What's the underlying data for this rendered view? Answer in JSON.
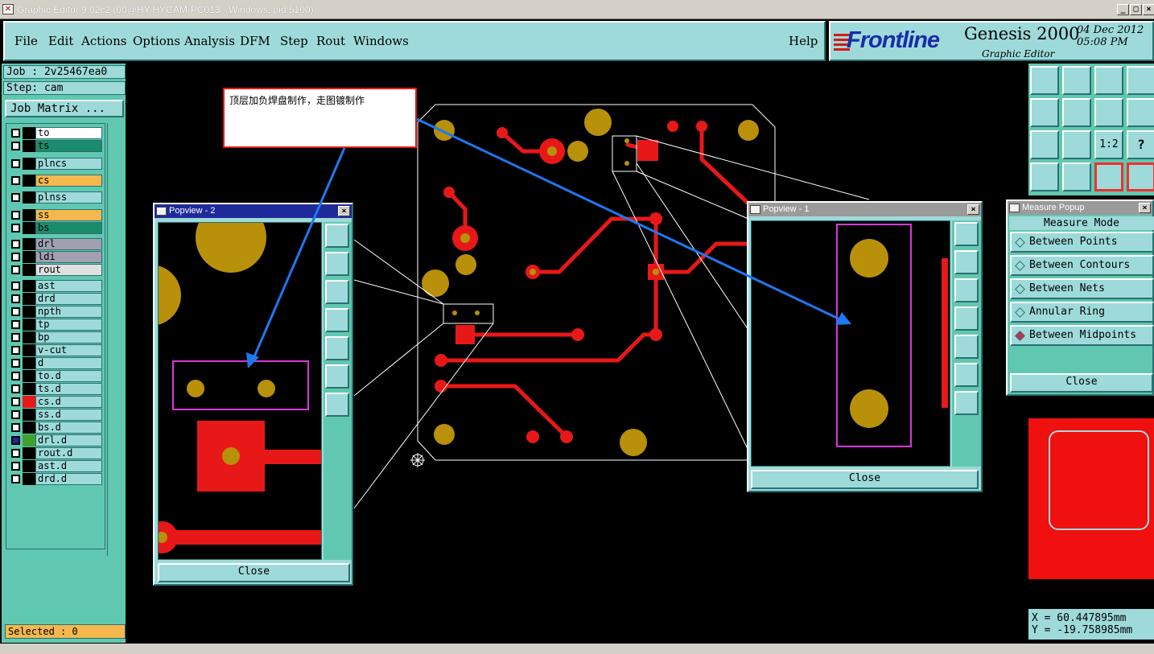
{
  "window": {
    "title": "Graphic Editor 9.02c2 (00@HY-HYCAM-PC013 - Windows, pid:5100)"
  },
  "menu": {
    "items": [
      "File",
      "Edit",
      "Actions",
      "Options",
      "Analysis",
      "DFM",
      "Step",
      "Rout",
      "Windows"
    ],
    "help": "Help"
  },
  "brand": {
    "logo": "Frontline",
    "product": "Genesis 2000",
    "subtitle": "Graphic Editor",
    "date": "04 Dec 2012",
    "time": "05:08 PM"
  },
  "job": {
    "job_label": "Job : 2v25467ea0",
    "step_label": "Step: cam",
    "matrix_button": "Job Matrix ..."
  },
  "layers": [
    {
      "name": "to",
      "color": "#ffffff",
      "swatch": "#000000"
    },
    {
      "name": "ts",
      "color": "#1a8c6c",
      "swatch": "#000000"
    },
    {
      "name": "plncs",
      "color": "#9edada",
      "swatch": "#000000"
    },
    {
      "name": "cs",
      "color": "#f4b84e",
      "swatch": "#000000"
    },
    {
      "name": "plnss",
      "color": "#9edada",
      "swatch": "#000000"
    },
    {
      "name": "ss",
      "color": "#f4b84e",
      "swatch": "#000000"
    },
    {
      "name": "bs",
      "color": "#1a8c6c",
      "swatch": "#000000"
    },
    {
      "name": "drl",
      "color": "#a0a0b0",
      "swatch": "#000000"
    },
    {
      "name": "ldi",
      "color": "#a0a0b0",
      "swatch": "#000000"
    },
    {
      "name": "rout",
      "color": "#e0e0e0",
      "swatch": "#000000"
    },
    {
      "name": "ast",
      "color": "#9edada",
      "swatch": "#000000"
    },
    {
      "name": "drd",
      "color": "#9edada",
      "swatch": "#000000"
    },
    {
      "name": "npth",
      "color": "#9edada",
      "swatch": "#000000"
    },
    {
      "name": "tp",
      "color": "#9edada",
      "swatch": "#000000"
    },
    {
      "name": "bp",
      "color": "#9edada",
      "swatch": "#000000"
    },
    {
      "name": "v-cut",
      "color": "#9edada",
      "swatch": "#000000"
    },
    {
      "name": "d",
      "color": "#9edada",
      "swatch": "#000000"
    },
    {
      "name": "to.d",
      "color": "#9edada",
      "swatch": "#000000"
    },
    {
      "name": "ts.d",
      "color": "#9edada",
      "swatch": "#000000"
    },
    {
      "name": "cs.d",
      "color": "#9edada",
      "swatch": "#e81818"
    },
    {
      "name": "ss.d",
      "color": "#9edada",
      "swatch": "#000000"
    },
    {
      "name": "bs.d",
      "color": "#9edada",
      "swatch": "#000000"
    },
    {
      "name": "drl.d",
      "color": "#9edada",
      "swatch": "#40a030"
    },
    {
      "name": "rout.d",
      "color": "#9edada",
      "swatch": "#000000"
    },
    {
      "name": "ast.d",
      "color": "#9edada",
      "swatch": "#000000"
    },
    {
      "name": "drd.d",
      "color": "#9edada",
      "swatch": "#000000"
    }
  ],
  "selected": "Selected : 0",
  "callout": {
    "text": "顶层加负焊盘制作，走图镀制作"
  },
  "popview2": {
    "title": "Popview - 2",
    "close": "Close"
  },
  "popview1": {
    "title": "Popview - 1",
    "close": "Close"
  },
  "measure": {
    "title": "Measure Popup",
    "mode_label": "Measure Mode",
    "options": [
      {
        "label": "Between Points",
        "selected": false
      },
      {
        "label": "Between Contours",
        "selected": false
      },
      {
        "label": "Between Nets",
        "selected": false
      },
      {
        "label": "Annular Ring",
        "selected": false
      },
      {
        "label": "Between Midpoints",
        "selected": true
      }
    ],
    "close": "Close"
  },
  "coords": {
    "x": "X =  60.447895mm",
    "y": "Y = -19.758985mm"
  },
  "colors": {
    "pad": "#b8900a",
    "trace": "#e81818",
    "panel": "#9edada",
    "accent": "#60c8b0"
  }
}
